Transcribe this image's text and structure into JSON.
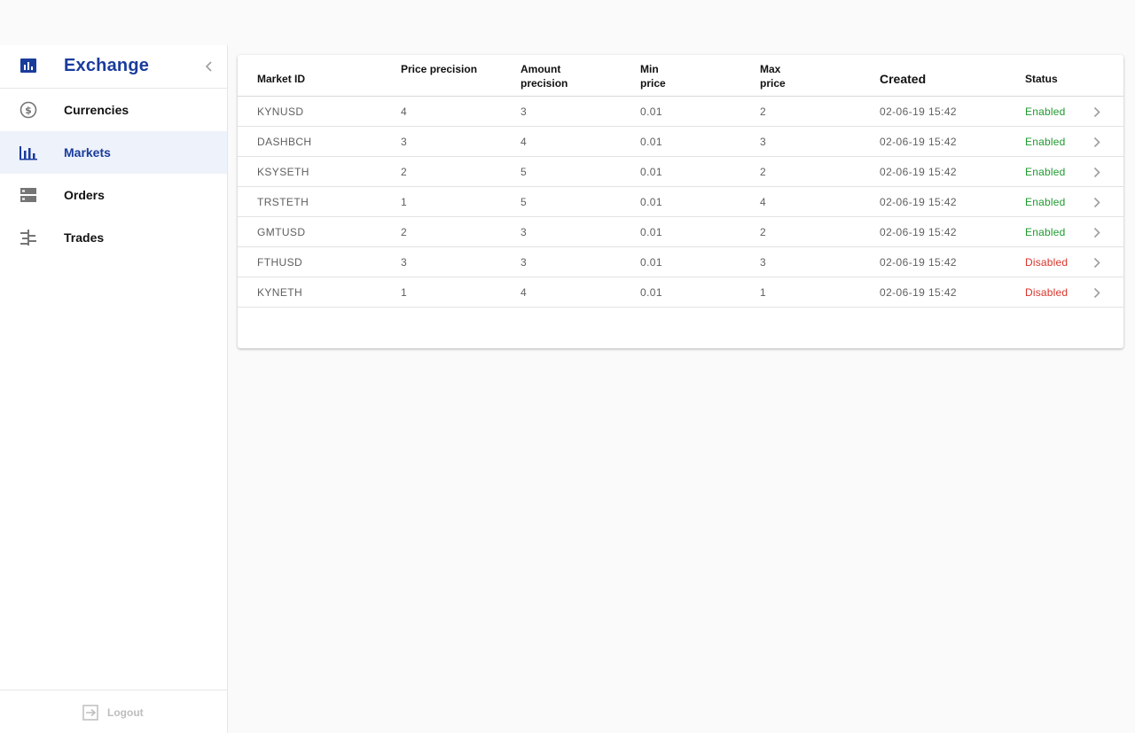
{
  "app": {
    "title": "Exchange"
  },
  "sidebar": {
    "items": [
      {
        "label": "Currencies",
        "icon": "currency-icon",
        "active": false
      },
      {
        "label": "Markets",
        "icon": "bar-chart-icon",
        "active": true
      },
      {
        "label": "Orders",
        "icon": "orders-icon",
        "active": false
      },
      {
        "label": "Trades",
        "icon": "trades-icon",
        "active": false
      }
    ],
    "logout_label": "Logout"
  },
  "table": {
    "headers": {
      "market_id": "Market ID",
      "price_precision": "Price precision",
      "amount_precision": "Amount precision",
      "min_price": "Min price",
      "max_price": "Max price",
      "created": "Created",
      "status": "Status"
    },
    "rows": [
      {
        "market_id": "KYNUSD",
        "price_precision": "4",
        "amount_precision": "3",
        "min_price": "0.01",
        "max_price": "2",
        "created": "02-06-19 15:42",
        "status": "Enabled"
      },
      {
        "market_id": "DASHBCH",
        "price_precision": "3",
        "amount_precision": "4",
        "min_price": "0.01",
        "max_price": "3",
        "created": "02-06-19 15:42",
        "status": "Enabled"
      },
      {
        "market_id": "KSYSETH",
        "price_precision": "2",
        "amount_precision": "5",
        "min_price": "0.01",
        "max_price": "2",
        "created": "02-06-19 15:42",
        "status": "Enabled"
      },
      {
        "market_id": "TRSTETH",
        "price_precision": "1",
        "amount_precision": "5",
        "min_price": "0.01",
        "max_price": "4",
        "created": "02-06-19 15:42",
        "status": "Enabled"
      },
      {
        "market_id": "GMTUSD",
        "price_precision": "2",
        "amount_precision": "3",
        "min_price": "0.01",
        "max_price": "2",
        "created": "02-06-19 15:42",
        "status": "Enabled"
      },
      {
        "market_id": "FTHUSD",
        "price_precision": "3",
        "amount_precision": "3",
        "min_price": "0.01",
        "max_price": "3",
        "created": "02-06-19 15:42",
        "status": "Disabled"
      },
      {
        "market_id": "KYNETH",
        "price_precision": "1",
        "amount_precision": "4",
        "min_price": "0.01",
        "max_price": "1",
        "created": "02-06-19 15:42",
        "status": "Disabled"
      }
    ]
  },
  "colors": {
    "brand": "#1a3c9c",
    "enabled": "#1e9a2e",
    "disabled": "#d8332b",
    "active_bg": "#eef2fb"
  }
}
